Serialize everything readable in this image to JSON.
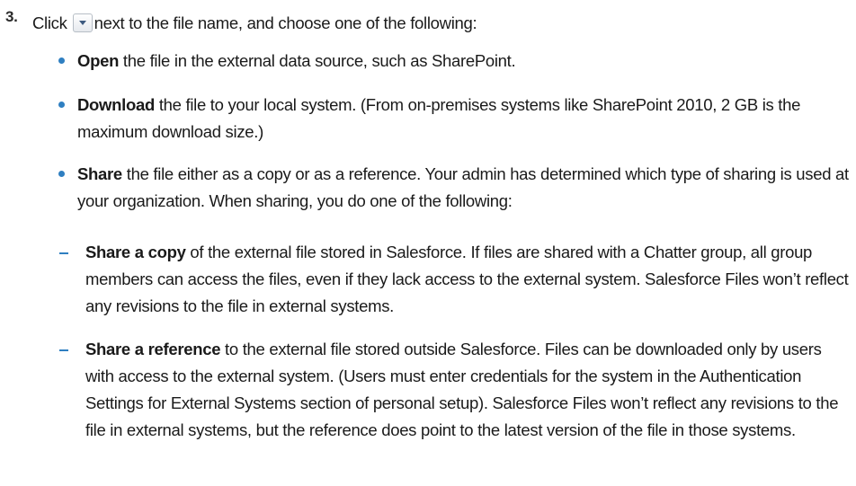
{
  "step": {
    "number": "3.",
    "text_before": "Click",
    "icon": "dropdown-arrow-icon",
    "text_after": "next to the file name, and choose one of the following:"
  },
  "options": [
    {
      "term": "Open",
      "text": " the file in the external data source, such as SharePoint."
    },
    {
      "term": "Download",
      "text": " the file to your local system. (From on-premises systems like SharePoint 2010, 2 GB is the maximum download size.)"
    },
    {
      "term": "Share",
      "text": " the file either as a copy or as a reference. Your admin has determined which type of sharing is used at your organization. When sharing, you do one of the following:"
    }
  ],
  "share_options": [
    {
      "term": "Share a copy",
      "text": " of the external file stored in Salesforce. If files are shared with a Chatter group, all group members can access the files, even if they lack access to the external system. Salesforce Files won’t reflect any revisions to the file in external systems."
    },
    {
      "term": "Share a reference",
      "text": " to the external file stored outside Salesforce. Files can be downloaded only by users with access to the external system. (Users must enter credentials for the system in the Authentication Settings for External Systems section of personal setup). Salesforce Files won’t reflect any revisions to the file in external systems, but the reference does point to the latest version of the file in those systems."
    }
  ],
  "colors": {
    "bullet": "#2f7fc1",
    "text": "#1a1a1a"
  }
}
